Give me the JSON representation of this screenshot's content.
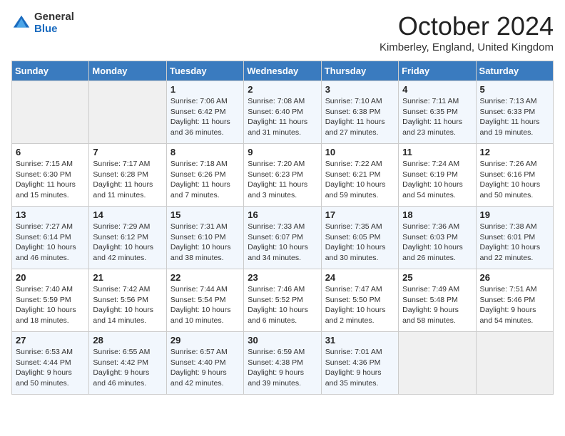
{
  "header": {
    "logo_general": "General",
    "logo_blue": "Blue",
    "month_title": "October 2024",
    "subtitle": "Kimberley, England, United Kingdom"
  },
  "days_of_week": [
    "Sunday",
    "Monday",
    "Tuesday",
    "Wednesday",
    "Thursday",
    "Friday",
    "Saturday"
  ],
  "weeks": [
    [
      {
        "day": "",
        "info": ""
      },
      {
        "day": "",
        "info": ""
      },
      {
        "day": "1",
        "info": "Sunrise: 7:06 AM\nSunset: 6:42 PM\nDaylight: 11 hours and 36 minutes."
      },
      {
        "day": "2",
        "info": "Sunrise: 7:08 AM\nSunset: 6:40 PM\nDaylight: 11 hours and 31 minutes."
      },
      {
        "day": "3",
        "info": "Sunrise: 7:10 AM\nSunset: 6:38 PM\nDaylight: 11 hours and 27 minutes."
      },
      {
        "day": "4",
        "info": "Sunrise: 7:11 AM\nSunset: 6:35 PM\nDaylight: 11 hours and 23 minutes."
      },
      {
        "day": "5",
        "info": "Sunrise: 7:13 AM\nSunset: 6:33 PM\nDaylight: 11 hours and 19 minutes."
      }
    ],
    [
      {
        "day": "6",
        "info": "Sunrise: 7:15 AM\nSunset: 6:30 PM\nDaylight: 11 hours and 15 minutes."
      },
      {
        "day": "7",
        "info": "Sunrise: 7:17 AM\nSunset: 6:28 PM\nDaylight: 11 hours and 11 minutes."
      },
      {
        "day": "8",
        "info": "Sunrise: 7:18 AM\nSunset: 6:26 PM\nDaylight: 11 hours and 7 minutes."
      },
      {
        "day": "9",
        "info": "Sunrise: 7:20 AM\nSunset: 6:23 PM\nDaylight: 11 hours and 3 minutes."
      },
      {
        "day": "10",
        "info": "Sunrise: 7:22 AM\nSunset: 6:21 PM\nDaylight: 10 hours and 59 minutes."
      },
      {
        "day": "11",
        "info": "Sunrise: 7:24 AM\nSunset: 6:19 PM\nDaylight: 10 hours and 54 minutes."
      },
      {
        "day": "12",
        "info": "Sunrise: 7:26 AM\nSunset: 6:16 PM\nDaylight: 10 hours and 50 minutes."
      }
    ],
    [
      {
        "day": "13",
        "info": "Sunrise: 7:27 AM\nSunset: 6:14 PM\nDaylight: 10 hours and 46 minutes."
      },
      {
        "day": "14",
        "info": "Sunrise: 7:29 AM\nSunset: 6:12 PM\nDaylight: 10 hours and 42 minutes."
      },
      {
        "day": "15",
        "info": "Sunrise: 7:31 AM\nSunset: 6:10 PM\nDaylight: 10 hours and 38 minutes."
      },
      {
        "day": "16",
        "info": "Sunrise: 7:33 AM\nSunset: 6:07 PM\nDaylight: 10 hours and 34 minutes."
      },
      {
        "day": "17",
        "info": "Sunrise: 7:35 AM\nSunset: 6:05 PM\nDaylight: 10 hours and 30 minutes."
      },
      {
        "day": "18",
        "info": "Sunrise: 7:36 AM\nSunset: 6:03 PM\nDaylight: 10 hours and 26 minutes."
      },
      {
        "day": "19",
        "info": "Sunrise: 7:38 AM\nSunset: 6:01 PM\nDaylight: 10 hours and 22 minutes."
      }
    ],
    [
      {
        "day": "20",
        "info": "Sunrise: 7:40 AM\nSunset: 5:59 PM\nDaylight: 10 hours and 18 minutes."
      },
      {
        "day": "21",
        "info": "Sunrise: 7:42 AM\nSunset: 5:56 PM\nDaylight: 10 hours and 14 minutes."
      },
      {
        "day": "22",
        "info": "Sunrise: 7:44 AM\nSunset: 5:54 PM\nDaylight: 10 hours and 10 minutes."
      },
      {
        "day": "23",
        "info": "Sunrise: 7:46 AM\nSunset: 5:52 PM\nDaylight: 10 hours and 6 minutes."
      },
      {
        "day": "24",
        "info": "Sunrise: 7:47 AM\nSunset: 5:50 PM\nDaylight: 10 hours and 2 minutes."
      },
      {
        "day": "25",
        "info": "Sunrise: 7:49 AM\nSunset: 5:48 PM\nDaylight: 9 hours and 58 minutes."
      },
      {
        "day": "26",
        "info": "Sunrise: 7:51 AM\nSunset: 5:46 PM\nDaylight: 9 hours and 54 minutes."
      }
    ],
    [
      {
        "day": "27",
        "info": "Sunrise: 6:53 AM\nSunset: 4:44 PM\nDaylight: 9 hours and 50 minutes."
      },
      {
        "day": "28",
        "info": "Sunrise: 6:55 AM\nSunset: 4:42 PM\nDaylight: 9 hours and 46 minutes."
      },
      {
        "day": "29",
        "info": "Sunrise: 6:57 AM\nSunset: 4:40 PM\nDaylight: 9 hours and 42 minutes."
      },
      {
        "day": "30",
        "info": "Sunrise: 6:59 AM\nSunset: 4:38 PM\nDaylight: 9 hours and 39 minutes."
      },
      {
        "day": "31",
        "info": "Sunrise: 7:01 AM\nSunset: 4:36 PM\nDaylight: 9 hours and 35 minutes."
      },
      {
        "day": "",
        "info": ""
      },
      {
        "day": "",
        "info": ""
      }
    ]
  ]
}
